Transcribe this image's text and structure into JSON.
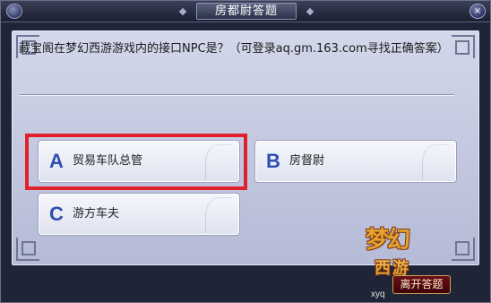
{
  "window": {
    "title": "房都尉答题",
    "close_label": "×"
  },
  "question": {
    "text": "藏宝阁在梦幻西游游戏内的接口NPC是？（可登录aq.gm.163.com寻找正确答案）"
  },
  "options": [
    {
      "letter": "A",
      "label": "贸易车队总管",
      "highlighted": true
    },
    {
      "letter": "B",
      "label": "房督尉",
      "highlighted": false
    },
    {
      "letter": "C",
      "label": "游方车夫",
      "highlighted": false
    }
  ],
  "footer": {
    "leave_label": "离开答题",
    "logo_text": "梦幻",
    "logo_sub": "西游",
    "watermark": "xyq"
  },
  "colors": {
    "highlight": "#e0212b",
    "option_letter": "#2f4fb0"
  }
}
